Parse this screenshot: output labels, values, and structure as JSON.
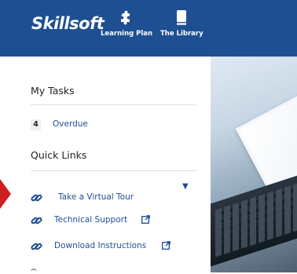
{
  "header": {
    "logo_text": "Skillsoft",
    "nav": [
      {
        "label": "Learning Plan",
        "icon": "puzzle-icon"
      },
      {
        "label": "The Library",
        "icon": "book-icon"
      }
    ]
  },
  "sidebar": {
    "my_tasks_title": "My Tasks",
    "overdue_count": "4",
    "overdue_label": "Overdue",
    "quick_links_title": "Quick Links",
    "links": [
      {
        "label": "Take a Virtual Tour",
        "icon": "link-icon",
        "external": false,
        "expanded_caret": true
      },
      {
        "label": "Technical Support",
        "icon": "link-icon",
        "external": true
      },
      {
        "label": "Download Instructions",
        "icon": "link-icon",
        "external": true
      }
    ]
  },
  "colors": {
    "header_bg": "#1e4f93",
    "link": "#1e4f93",
    "arrow": "#cc1f1f"
  }
}
